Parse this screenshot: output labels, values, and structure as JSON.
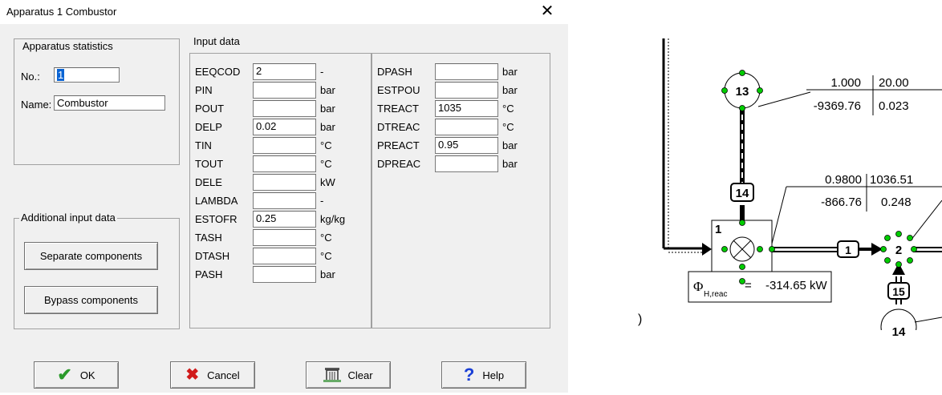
{
  "window": {
    "title": "Apparatus 1  Combustor",
    "close_glyph": "✕"
  },
  "stats": {
    "legend": "Apparatus statistics",
    "no_label": "No.:",
    "no_value": "1",
    "name_label": "Name:",
    "name_value": "Combustor"
  },
  "additional": {
    "legend": "Additional input data",
    "separate_label": "Separate components",
    "bypass_label": "Bypass components"
  },
  "input": {
    "legend": "Input data",
    "left": [
      {
        "name": "EEQCOD",
        "value": "2",
        "unit": "-"
      },
      {
        "name": "PIN",
        "value": "",
        "unit": "bar"
      },
      {
        "name": "POUT",
        "value": "",
        "unit": "bar"
      },
      {
        "name": "DELP",
        "value": "0.02",
        "unit": "bar"
      },
      {
        "name": "TIN",
        "value": "",
        "unit": "°C"
      },
      {
        "name": "TOUT",
        "value": "",
        "unit": "°C"
      },
      {
        "name": "DELE",
        "value": "",
        "unit": "kW"
      },
      {
        "name": "LAMBDA",
        "value": "",
        "unit": "-"
      },
      {
        "name": "ESTOFR",
        "value": "0.25",
        "unit": "kg/kg"
      },
      {
        "name": "TASH",
        "value": "",
        "unit": "°C"
      },
      {
        "name": "DTASH",
        "value": "",
        "unit": "°C"
      },
      {
        "name": "PASH",
        "value": "",
        "unit": "bar"
      }
    ],
    "right": [
      {
        "name": "DPASH",
        "value": "",
        "unit": "bar"
      },
      {
        "name": "ESTPOU",
        "value": "",
        "unit": "bar"
      },
      {
        "name": "TREACT",
        "value": "1035",
        "unit": "°C"
      },
      {
        "name": "DTREAC",
        "value": "",
        "unit": "°C"
      },
      {
        "name": "PREACT",
        "value": "0.95",
        "unit": "bar"
      },
      {
        "name": "DPREAC",
        "value": "",
        "unit": "bar"
      }
    ]
  },
  "buttons": {
    "ok": "OK",
    "cancel": "Cancel",
    "clear": "Clear",
    "help": "Help"
  },
  "diagram": {
    "node13": "13",
    "node14_label": "14",
    "node1": "1",
    "stream1": "1",
    "node2": "2",
    "node15": "15",
    "node14b": "14",
    "box13": {
      "tl": "1.000",
      "tr": "20.00",
      "bl": "-9369.76",
      "br": "0.023"
    },
    "box14": {
      "tl": "0.9800",
      "tr": "1036.51",
      "bl": "-866.76",
      "br": "0.248"
    },
    "phi_symbol": "Φ",
    "phi_sub": "H,reac",
    "phi_eq": "=",
    "phi_value": "-314.65 kW",
    "bracket": ")"
  },
  "colors": {
    "node_dot": "#00cc00",
    "selection": "#0a64d4",
    "ok_check": "#2a9a2a",
    "cancel_x": "#d11a1a",
    "help_q": "#1a3fd6"
  }
}
